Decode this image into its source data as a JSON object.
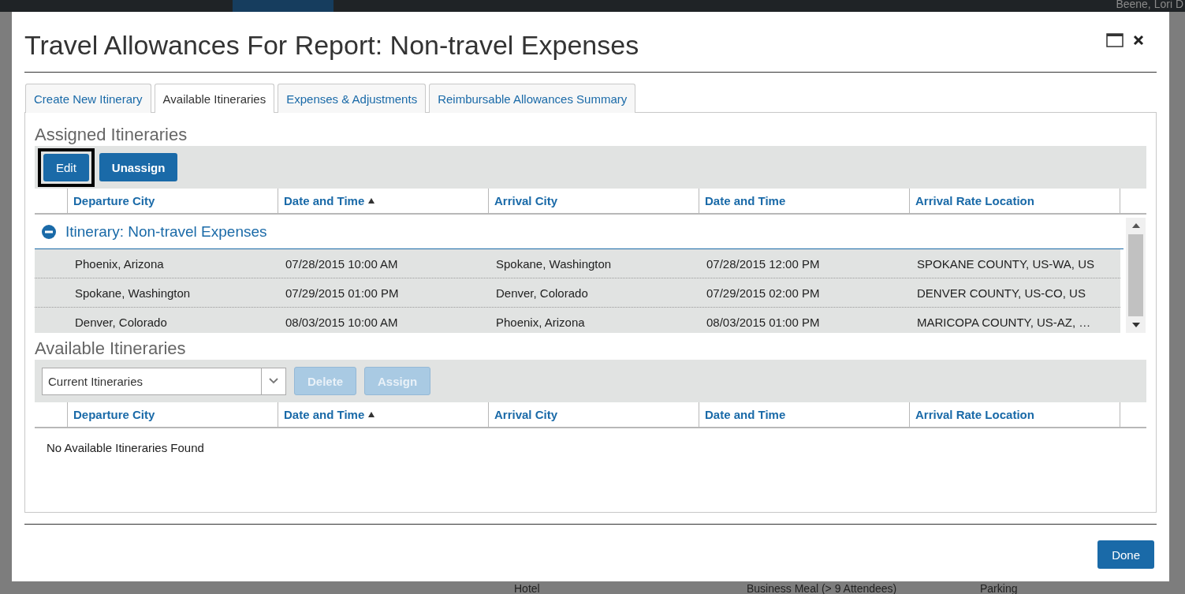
{
  "background": {
    "user_name": "Beene, Lori D",
    "bottom_row": [
      "Hotel",
      "Business Meal (> 9 Attendees)",
      "Parking"
    ]
  },
  "dialog": {
    "title": "Travel Allowances For Report: Non-travel Expenses",
    "tabs": [
      {
        "label": "Create New Itinerary",
        "selected": false
      },
      {
        "label": "Available Itineraries",
        "selected": true
      },
      {
        "label": "Expenses & Adjustments",
        "selected": false
      },
      {
        "label": "Reimbursable Allowances Summary",
        "selected": false
      }
    ],
    "assigned": {
      "heading": "Assigned Itineraries",
      "buttons": [
        {
          "label": "Edit",
          "highlighted": true
        },
        {
          "label": "Unassign",
          "highlighted": false
        }
      ],
      "columns": [
        {
          "label": "Departure City",
          "sorted": false
        },
        {
          "label": "Date and Time",
          "sorted": true
        },
        {
          "label": "Arrival City",
          "sorted": false
        },
        {
          "label": "Date and Time",
          "sorted": false
        },
        {
          "label": "Arrival Rate Location",
          "sorted": false
        }
      ],
      "group": {
        "label": "Itinerary: Non-travel Expenses",
        "expanded": true
      },
      "rows": [
        [
          "Phoenix, Arizona",
          "07/28/2015 10:00 AM",
          "Spokane, Washington",
          "07/28/2015 12:00 PM",
          "SPOKANE COUNTY, US-WA, US"
        ],
        [
          "Spokane, Washington",
          "07/29/2015 01:00 PM",
          "Denver, Colorado",
          "07/29/2015 02:00 PM",
          "DENVER COUNTY, US-CO, US"
        ],
        [
          "Denver, Colorado",
          "08/03/2015 10:00 AM",
          "Phoenix, Arizona",
          "08/03/2015 01:00 PM",
          "MARICOPA COUNTY, US-AZ, …"
        ]
      ]
    },
    "available": {
      "heading": "Available Itineraries",
      "filter": {
        "value": "Current Itineraries"
      },
      "buttons": [
        {
          "label": "Delete",
          "disabled": true
        },
        {
          "label": "Assign",
          "disabled": true
        }
      ],
      "columns": [
        {
          "label": "Departure City",
          "sorted": false
        },
        {
          "label": "Date and Time",
          "sorted": true
        },
        {
          "label": "Arrival City",
          "sorted": false
        },
        {
          "label": "Date and Time",
          "sorted": false
        },
        {
          "label": "Arrival Rate Location",
          "sorted": false
        }
      ],
      "empty_message": "No Available Itineraries Found"
    },
    "done_button": "Done"
  }
}
